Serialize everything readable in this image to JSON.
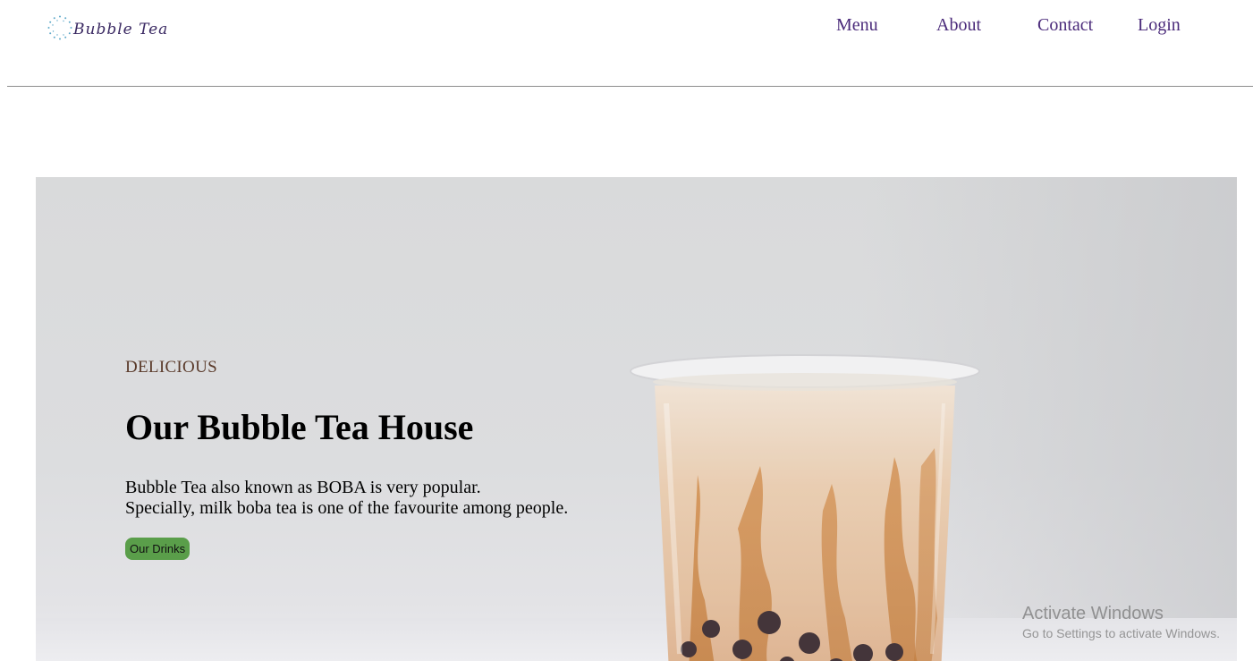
{
  "header": {
    "logo_text": "Bubble Tea",
    "nav": {
      "menu": "Menu",
      "about": "About",
      "contact": "Contact",
      "login": "Login"
    }
  },
  "hero": {
    "eyebrow": "DELICIOUS",
    "title": "Our Bubble Tea House",
    "description_line1": "Bubble Tea also known as BOBA is very popular.",
    "description_line2": "Specially, milk boba tea is one of the favourite among people.",
    "button_label": "Our Drinks"
  },
  "watermark": {
    "title": "Activate Windows",
    "subtitle": "Go to Settings to activate Windows."
  },
  "colors": {
    "nav_text": "#4a2a7a",
    "logo_text": "#3b2a63",
    "button_bg": "#5a9e4a",
    "eyebrow_text": "#5a3a2a"
  },
  "icons": {
    "logo": "dotted-circle-icon"
  }
}
